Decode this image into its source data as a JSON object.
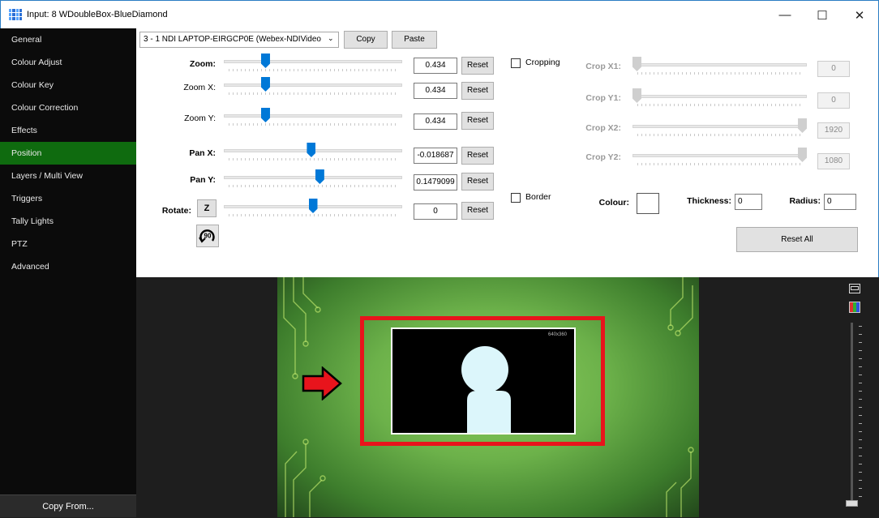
{
  "window": {
    "title": "Input: 8 WDoubleBox-BlueDiamond",
    "controls": [
      "—",
      "☐",
      "✕"
    ]
  },
  "sidebar": {
    "items": [
      {
        "label": "General"
      },
      {
        "label": "Colour Adjust"
      },
      {
        "label": "Colour Key"
      },
      {
        "label": "Colour Correction"
      },
      {
        "label": "Effects"
      },
      {
        "label": "Position",
        "active": true
      },
      {
        "label": "Layers / Multi View"
      },
      {
        "label": "Triggers"
      },
      {
        "label": "Tally Lights"
      },
      {
        "label": "PTZ"
      },
      {
        "label": "Advanced"
      }
    ],
    "copy_from": "Copy From..."
  },
  "source": {
    "selected": "3 - 1 NDI LAPTOP-EIRGCP0E (Webex-NDIVideo",
    "copy_label": "Copy",
    "paste_label": "Paste"
  },
  "position": {
    "zoom": {
      "label": "Zoom:",
      "value": "0.434",
      "level": 0.22
    },
    "zoom_x": {
      "label": "Zoom X:",
      "value": "0.434",
      "level": 0.22
    },
    "zoom_y": {
      "label": "Zoom Y:",
      "value": "0.434",
      "level": 0.22
    },
    "pan_x": {
      "label": "Pan X:",
      "value": "-0.018687",
      "level": 0.49
    },
    "pan_y": {
      "label": "Pan Y:",
      "value": "0.1479099",
      "level": 0.54
    },
    "rotate": {
      "label": "Rotate:",
      "value": "0",
      "level": 0.5,
      "z_label": "Z"
    },
    "reset_label": "Reset",
    "rotate90_label": "90"
  },
  "cropping": {
    "label": "Cropping",
    "x1": {
      "label": "Crop X1:",
      "value": "0",
      "level": 0.0
    },
    "y1": {
      "label": "Crop Y1:",
      "value": "0",
      "level": 0.0
    },
    "x2": {
      "label": "Crop X2:",
      "value": "1920",
      "level": 1.0
    },
    "y2": {
      "label": "Crop Y2:",
      "value": "1080",
      "level": 1.0
    }
  },
  "border": {
    "label": "Border",
    "colour_label": "Colour:",
    "thickness_label": "Thickness:",
    "thickness_value": "0",
    "radius_label": "Radius:",
    "radius_value": "0",
    "reset_all_label": "Reset All"
  },
  "preview": {
    "resolution_label": "640x360"
  },
  "colors": {
    "accent": "#0078d7",
    "active_sidebar": "#0f6b0f",
    "highlight_frame": "#e8141c",
    "arrow": "#e8141c"
  }
}
